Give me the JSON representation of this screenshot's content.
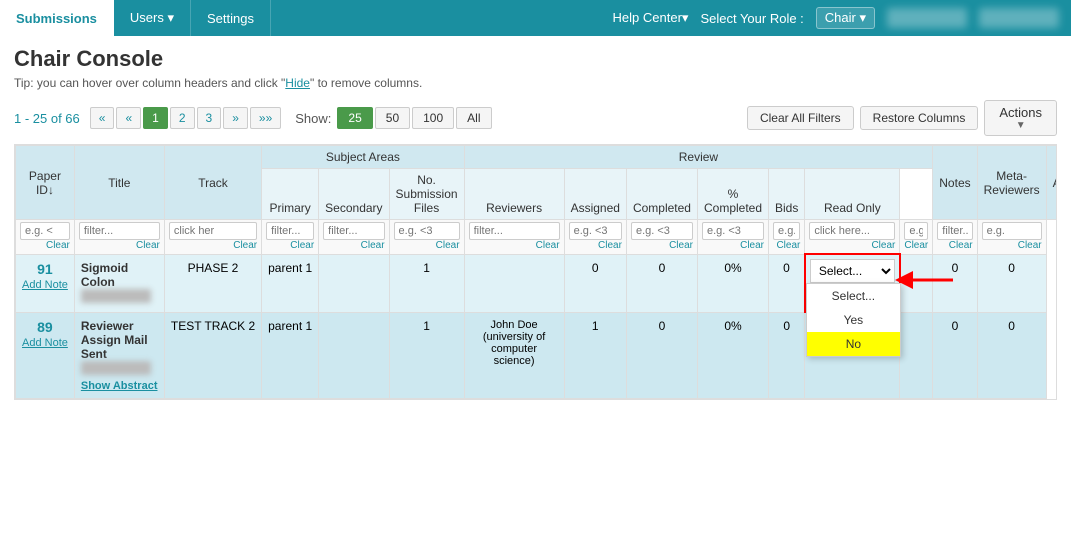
{
  "nav": {
    "tabs": [
      {
        "label": "Submissions",
        "active": true
      },
      {
        "label": "Users ▾",
        "active": false
      },
      {
        "label": "Settings",
        "active": false
      }
    ],
    "right": {
      "help": "Help Center▾",
      "role_label": "Select Your Role :",
      "role_value": "Chair ▾"
    }
  },
  "page": {
    "title": "Chair Console",
    "tip": "Tip: you can hover over column headers and click \"Hide\" to remove columns."
  },
  "toolbar": {
    "pagination_info": "1 - 25 of 66",
    "pages": [
      "«",
      "«",
      "1",
      "2",
      "3",
      "»",
      "»»"
    ],
    "show_label": "Show:",
    "show_options": [
      "25",
      "50",
      "100",
      "All"
    ],
    "active_show": "25",
    "clear_filters": "Clear All Filters",
    "restore_columns": "Restore Columns",
    "actions": "Actions"
  },
  "table": {
    "group_headers": [
      {
        "label": "Subject Areas",
        "colspan": 3
      },
      {
        "label": "Review",
        "colspan": 7
      }
    ],
    "col_headers": [
      "Paper ID↓",
      "Title",
      "Track",
      "Primary",
      "Secondary",
      "No. Submission Files",
      "Reviewers",
      "Assigned",
      "Completed",
      "% Completed",
      "Bids",
      "Read Only",
      "Notes",
      "Meta-Reviewers",
      "Assig..."
    ],
    "filter_placeholders": [
      "e.g. <",
      "filter...",
      "click her",
      "filter...",
      "filter...",
      "e.g. <3",
      "filter...",
      "e.g. <3",
      "e.g. <3",
      "e.g. <3",
      "e.g.",
      "click here...",
      "e.g.",
      "filter...",
      "e.g."
    ],
    "rows": [
      {
        "paper_id": "91",
        "title": "Sigmoid Colon",
        "track": "PHASE 2",
        "primary": "parent 1",
        "secondary": "",
        "files": "1",
        "reviewers": "",
        "assigned": "0",
        "completed": "0",
        "pct_completed": "0%",
        "bids": "0",
        "read_only": "Select... ▾",
        "notes": "",
        "meta_reviewers": "0",
        "assig": "0",
        "has_dropdown": true
      },
      {
        "paper_id": "89",
        "title": "Reviewer Assign Mail Sent",
        "track": "TEST TRACK 2",
        "primary": "parent 1",
        "secondary": "",
        "files": "1",
        "reviewers": "John Doe (university of computer science)",
        "assigned": "1",
        "completed": "0",
        "pct_completed": "0%",
        "bids": "0",
        "read_only": "Yes",
        "notes": "",
        "meta_reviewers": "0",
        "assig": "0",
        "has_dropdown": false
      }
    ],
    "dropdown_options": [
      "Select...",
      "Yes",
      "No"
    ],
    "dropdown_highlighted": "No"
  }
}
